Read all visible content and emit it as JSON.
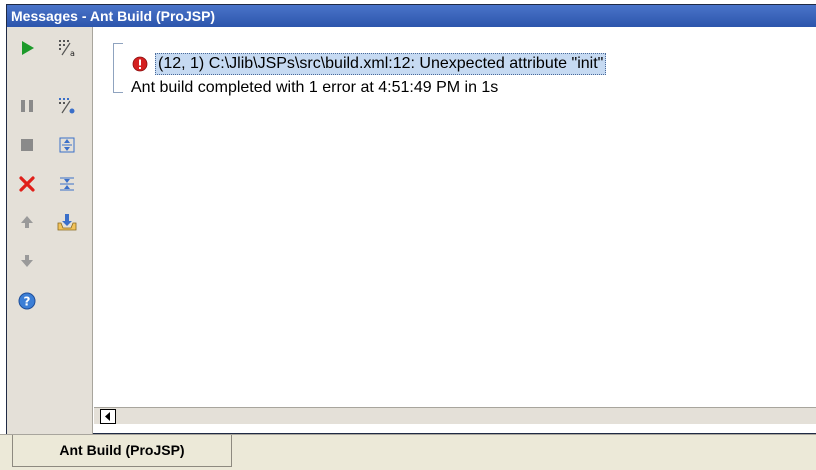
{
  "window": {
    "title": "Messages - Ant Build (ProJSP)"
  },
  "toolbar": {
    "buttons": [
      {
        "name": "run-icon"
      },
      {
        "name": "show-properties-icon"
      },
      {
        "name": "pause-icon"
      },
      {
        "name": "sort-messages-icon"
      },
      {
        "name": "stop-icon"
      },
      {
        "name": "expand-all-icon"
      },
      {
        "name": "close-icon"
      },
      {
        "name": "collapse-all-icon"
      },
      {
        "name": "previous-message-icon"
      },
      {
        "name": "export-icon"
      },
      {
        "name": "next-message-icon"
      },
      {
        "name": "help-icon"
      }
    ]
  },
  "messages": {
    "error_text": "(12, 1)  C:\\Jlib\\JSPs\\src\\build.xml:12: Unexpected attribute \"init\"",
    "summary_text": "Ant build completed with 1 error at 4:51:49 PM in 1s"
  },
  "tabs": [
    {
      "label": "Ant Build (ProJSP)",
      "selected": true
    }
  ],
  "colors": {
    "titlebar": "#2c55ac",
    "selection": "#c6daf2",
    "error_red": "#d42020",
    "run_green": "#1c9a2a"
  }
}
